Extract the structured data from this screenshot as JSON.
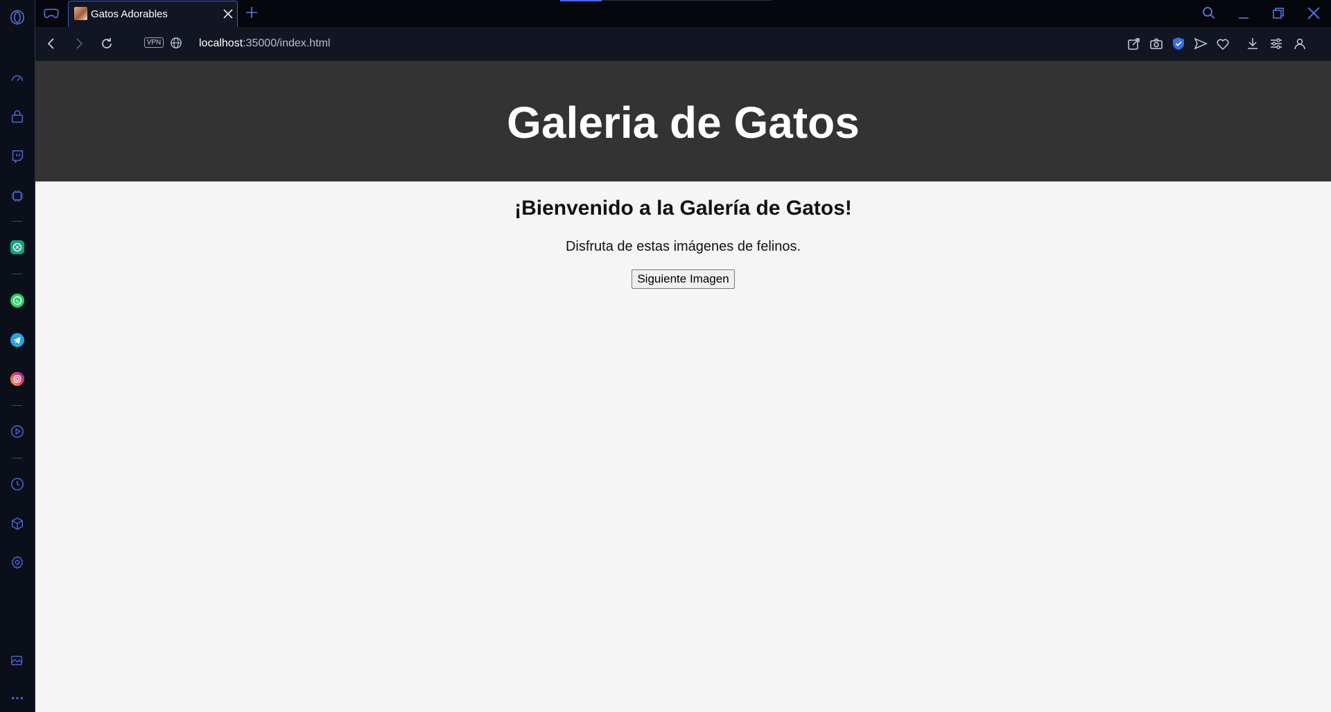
{
  "browser": {
    "tab": {
      "title": "Gatos Adorables"
    },
    "address": {
      "host": "localhost",
      "rest": ":35000/index.html"
    },
    "vpn_label": "VPN",
    "accent": "#3b6bf0"
  },
  "sidebar": {
    "items": [
      {
        "icon": "opera-logo-icon"
      },
      {
        "icon": "speed-dial-icon"
      },
      {
        "icon": "shopping-bag-icon"
      },
      {
        "icon": "twitch-icon"
      },
      {
        "icon": "ai-chip-icon"
      },
      {
        "icon": "chatgpt-icon"
      },
      {
        "icon": "whatsapp-icon"
      },
      {
        "icon": "telegram-icon"
      },
      {
        "icon": "instagram-icon"
      },
      {
        "icon": "player-icon"
      },
      {
        "icon": "history-icon"
      },
      {
        "icon": "cube-icon"
      },
      {
        "icon": "settings-gear-icon"
      },
      {
        "icon": "gallery-icon"
      },
      {
        "icon": "more-icon"
      }
    ]
  },
  "page": {
    "header_title": "Galeria de Gatos",
    "welcome": "¡Bienvenido a la Galería de Gatos!",
    "subtitle": "Disfruta de estas imágenes de felinos.",
    "next_button": "Siguiente Imagen"
  }
}
